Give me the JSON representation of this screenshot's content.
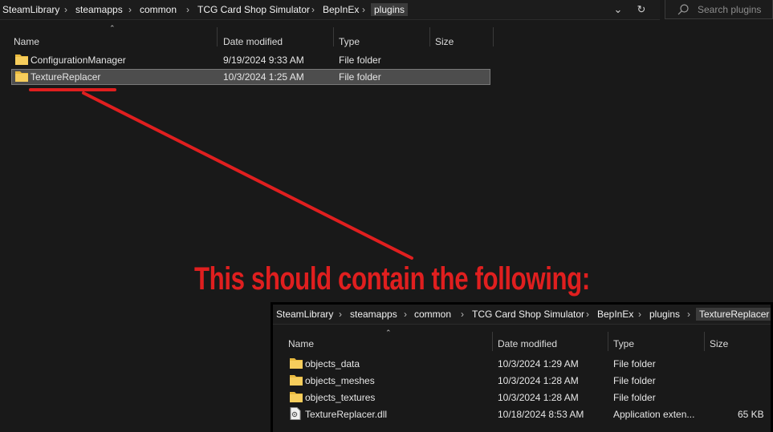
{
  "explorer": {
    "breadcrumb": [
      "SteamLibrary",
      "steamapps",
      "common",
      "TCG Card Shop Simulator",
      "BepInEx",
      "plugins"
    ],
    "search_placeholder": "Search plugins",
    "columns": {
      "name": "Name",
      "date": "Date modified",
      "type": "Type",
      "size": "Size"
    },
    "rows": [
      {
        "name": "ConfigurationManager",
        "date": "9/19/2024 9:33 AM",
        "type": "File folder",
        "size": "",
        "selected": false
      },
      {
        "name": "TextureReplacer",
        "date": "10/3/2024 1:25 AM",
        "type": "File folder",
        "size": "",
        "selected": true
      }
    ]
  },
  "annotation": {
    "text": "This should contain the following:",
    "color": "#e01f1f"
  },
  "inset": {
    "breadcrumb": [
      "SteamLibrary",
      "steamapps",
      "common",
      "TCG Card Shop Simulator",
      "BepInEx",
      "plugins",
      "TextureReplacer"
    ],
    "columns": {
      "name": "Name",
      "date": "Date modified",
      "type": "Type",
      "size": "Size"
    },
    "rows": [
      {
        "name": "objects_data",
        "date": "10/3/2024 1:29 AM",
        "type": "File folder",
        "size": "",
        "icon": "folder-icon"
      },
      {
        "name": "objects_meshes",
        "date": "10/3/2024 1:28 AM",
        "type": "File folder",
        "size": "",
        "icon": "folder-icon"
      },
      {
        "name": "objects_textures",
        "date": "10/3/2024 1:28 AM",
        "type": "File folder",
        "size": "",
        "icon": "folder-icon"
      },
      {
        "name": "TextureReplacer.dll",
        "date": "10/18/2024 8:53 AM",
        "type": "Application exten...",
        "size": "65 KB",
        "icon": "dll-file-icon"
      }
    ]
  },
  "colors": {
    "background": "#191919",
    "selection": "#4d4d4d",
    "folder": "#f3c34a",
    "annotation_red": "#e01f1f"
  }
}
